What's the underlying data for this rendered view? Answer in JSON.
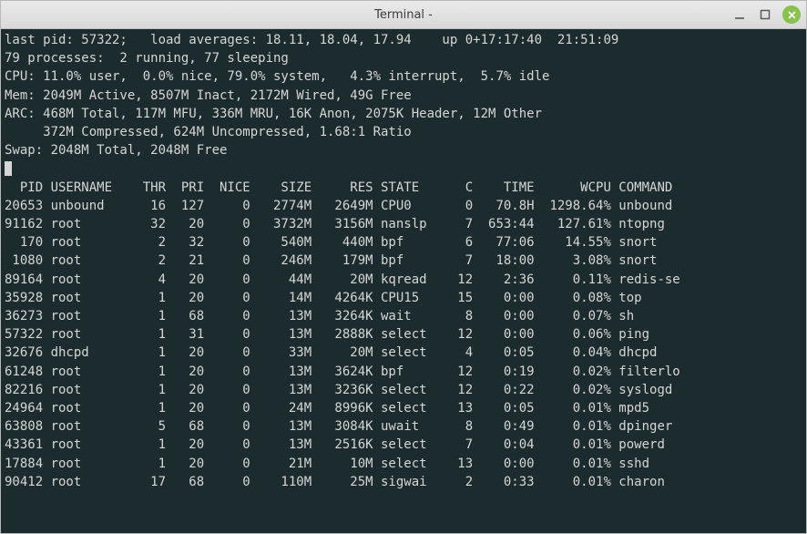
{
  "window": {
    "title": "Terminal -"
  },
  "header": {
    "last_pid_label": "last pid:",
    "last_pid": "57322",
    "load_averages_label": "load averages:",
    "load_averages": "18.11, 18.04, 17.94",
    "uptime": "up 0+17:17:40",
    "clock": "21:51:09",
    "proc_total": "79",
    "proc_label": "processes:",
    "proc_running": "2",
    "proc_running_label": "running,",
    "proc_sleeping": "77",
    "proc_sleeping_label": "sleeping",
    "cpu_label": "CPU:",
    "cpu_user": "11.0% user,",
    "cpu_nice": "0.0% nice,",
    "cpu_system": "79.0% system,",
    "cpu_interrupt": "4.3% interrupt,",
    "cpu_idle": "5.7% idle",
    "mem_label": "Mem:",
    "mem_active": "2049M Active,",
    "mem_inact": "8507M Inact,",
    "mem_wired": "2172M Wired,",
    "mem_free": "49G Free",
    "arc_label": "ARC:",
    "arc_total": "468M Total,",
    "arc_mfu": "117M MFU,",
    "arc_mru": "336M MRU,",
    "arc_anon": "16K Anon,",
    "arc_header": "2075K Header,",
    "arc_other": "12M Other",
    "arc_compressed": "372M Compressed,",
    "arc_uncompressed": "624M Uncompressed,",
    "arc_ratio": "1.68:1 Ratio",
    "swap_label": "Swap:",
    "swap_total": "2048M Total,",
    "swap_free": "2048M Free"
  },
  "columns": {
    "pid": "PID",
    "username": "USERNAME",
    "thr": "THR",
    "pri": "PRI",
    "nice": "NICE",
    "size": "SIZE",
    "res": "RES",
    "state": "STATE",
    "c": "C",
    "time": "TIME",
    "wcpu": "WCPU",
    "command": "COMMAND"
  },
  "rows": [
    {
      "pid": "20653",
      "user": "unbound",
      "thr": "16",
      "pri": "127",
      "nice": "0",
      "size": "2774M",
      "res": "2649M",
      "state": "CPU0",
      "c": "0",
      "time": "70.8H",
      "wcpu": "1298.64%",
      "cmd": "unbound"
    },
    {
      "pid": "91162",
      "user": "root",
      "thr": "32",
      "pri": "20",
      "nice": "0",
      "size": "3732M",
      "res": "3156M",
      "state": "nanslp",
      "c": "7",
      "time": "653:44",
      "wcpu": "127.61%",
      "cmd": "ntopng"
    },
    {
      "pid": "170",
      "user": "root",
      "thr": "2",
      "pri": "32",
      "nice": "0",
      "size": "540M",
      "res": "440M",
      "state": "bpf",
      "c": "6",
      "time": "77:06",
      "wcpu": "14.55%",
      "cmd": "snort"
    },
    {
      "pid": "1080",
      "user": "root",
      "thr": "2",
      "pri": "21",
      "nice": "0",
      "size": "246M",
      "res": "179M",
      "state": "bpf",
      "c": "7",
      "time": "18:00",
      "wcpu": "3.08%",
      "cmd": "snort"
    },
    {
      "pid": "89164",
      "user": "root",
      "thr": "4",
      "pri": "20",
      "nice": "0",
      "size": "44M",
      "res": "20M",
      "state": "kqread",
      "c": "12",
      "time": "2:36",
      "wcpu": "0.11%",
      "cmd": "redis-se"
    },
    {
      "pid": "35928",
      "user": "root",
      "thr": "1",
      "pri": "20",
      "nice": "0",
      "size": "14M",
      "res": "4264K",
      "state": "CPU15",
      "c": "15",
      "time": "0:00",
      "wcpu": "0.08%",
      "cmd": "top"
    },
    {
      "pid": "36273",
      "user": "root",
      "thr": "1",
      "pri": "68",
      "nice": "0",
      "size": "13M",
      "res": "3264K",
      "state": "wait",
      "c": "8",
      "time": "0:00",
      "wcpu": "0.07%",
      "cmd": "sh"
    },
    {
      "pid": "57322",
      "user": "root",
      "thr": "1",
      "pri": "31",
      "nice": "0",
      "size": "13M",
      "res": "2888K",
      "state": "select",
      "c": "12",
      "time": "0:00",
      "wcpu": "0.06%",
      "cmd": "ping"
    },
    {
      "pid": "32676",
      "user": "dhcpd",
      "thr": "1",
      "pri": "20",
      "nice": "0",
      "size": "33M",
      "res": "20M",
      "state": "select",
      "c": "4",
      "time": "0:05",
      "wcpu": "0.04%",
      "cmd": "dhcpd"
    },
    {
      "pid": "61248",
      "user": "root",
      "thr": "1",
      "pri": "20",
      "nice": "0",
      "size": "13M",
      "res": "3624K",
      "state": "bpf",
      "c": "12",
      "time": "0:19",
      "wcpu": "0.02%",
      "cmd": "filterlo"
    },
    {
      "pid": "82216",
      "user": "root",
      "thr": "1",
      "pri": "20",
      "nice": "0",
      "size": "13M",
      "res": "3236K",
      "state": "select",
      "c": "12",
      "time": "0:22",
      "wcpu": "0.02%",
      "cmd": "syslogd"
    },
    {
      "pid": "24964",
      "user": "root",
      "thr": "1",
      "pri": "20",
      "nice": "0",
      "size": "24M",
      "res": "8996K",
      "state": "select",
      "c": "13",
      "time": "0:05",
      "wcpu": "0.01%",
      "cmd": "mpd5"
    },
    {
      "pid": "63808",
      "user": "root",
      "thr": "5",
      "pri": "68",
      "nice": "0",
      "size": "13M",
      "res": "3084K",
      "state": "uwait",
      "c": "8",
      "time": "0:49",
      "wcpu": "0.01%",
      "cmd": "dpinger"
    },
    {
      "pid": "43361",
      "user": "root",
      "thr": "1",
      "pri": "20",
      "nice": "0",
      "size": "13M",
      "res": "2516K",
      "state": "select",
      "c": "7",
      "time": "0:04",
      "wcpu": "0.01%",
      "cmd": "powerd"
    },
    {
      "pid": "17884",
      "user": "root",
      "thr": "1",
      "pri": "20",
      "nice": "0",
      "size": "21M",
      "res": "10M",
      "state": "select",
      "c": "13",
      "time": "0:00",
      "wcpu": "0.01%",
      "cmd": "sshd"
    },
    {
      "pid": "90412",
      "user": "root",
      "thr": "17",
      "pri": "68",
      "nice": "0",
      "size": "110M",
      "res": "25M",
      "state": "sigwai",
      "c": "2",
      "time": "0:33",
      "wcpu": "0.01%",
      "cmd": "charon"
    }
  ]
}
